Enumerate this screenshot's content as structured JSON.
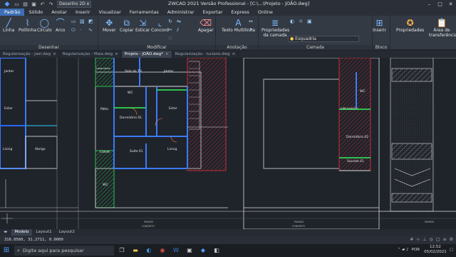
{
  "titlebar": {
    "workspace": "Desenho 2D e Anotaç",
    "title": "ZWCAD 2021 Versão Professional - [C:\\...\\Projeto - JOÃO.dwg]"
  },
  "menu": [
    "Padrão",
    "Sólido",
    "Anotar",
    "Inserir",
    "Visualizar",
    "Ferramentas",
    "Administrar",
    "Exportar",
    "Express",
    "Online"
  ],
  "ribbon": {
    "desenhar": {
      "label": "Desenhar",
      "tools": [
        "Linha",
        "Polilinha",
        "Círculo",
        "Arco"
      ]
    },
    "modificar": {
      "label": "Modificar",
      "tools": [
        "Mover",
        "Copiar",
        "Esticar",
        "Concord",
        "Apagar"
      ]
    },
    "anotacao": {
      "label": "Anotação",
      "tools": [
        "Texto Multilinha"
      ]
    },
    "camada": {
      "label": "Camada",
      "props": "Propriedades da camada",
      "layer_value": "Esquadria"
    },
    "bloco": {
      "label": "Bloco",
      "insert": "Inserir"
    },
    "propriedades": "Propriedades",
    "area": "Área de transferência"
  },
  "tabs": [
    {
      "label": "Regularização - joel.dwg",
      "active": false
    },
    {
      "label": "Regularização - Maia.dwg",
      "active": false
    },
    {
      "label": "Projeto - JOÃO.dwg*",
      "active": true
    },
    {
      "label": "Regularização - luciano.dwg",
      "active": false
    }
  ],
  "rooms": {
    "jantar_left": "Jantar",
    "estar_left": "Estar",
    "living_left": "Living",
    "abrigo_left": "Abrigo",
    "lavanderia": "Lavanderia",
    "sala_tv": "Sala de TV",
    "jantar": "Jantar",
    "wc1": "WC",
    "patio": "Pátio",
    "dormitorio01": "Dormitório 01",
    "estar": "Estar",
    "closet": "Closet",
    "suite01": "Suíte 01",
    "living": "Living",
    "wc2": "WC",
    "wc3": "WC",
    "circulacao": "CIRCULAÇÃO",
    "dormitorio02": "Dormitório 02",
    "sacada01": "Sacada 01",
    "passeio": "PASSEIO",
    "concreto": "CONCRETO"
  },
  "layout_tabs": [
    "Modelo",
    "Layout1",
    "Layout2"
  ],
  "status": {
    "coords": "316.0560, 31.2711, 0.0000"
  },
  "taskbar": {
    "search_placeholder": "Digite aqui para pesquisar",
    "lang": "POR",
    "time": "12:52",
    "date": "05/02/2021"
  }
}
